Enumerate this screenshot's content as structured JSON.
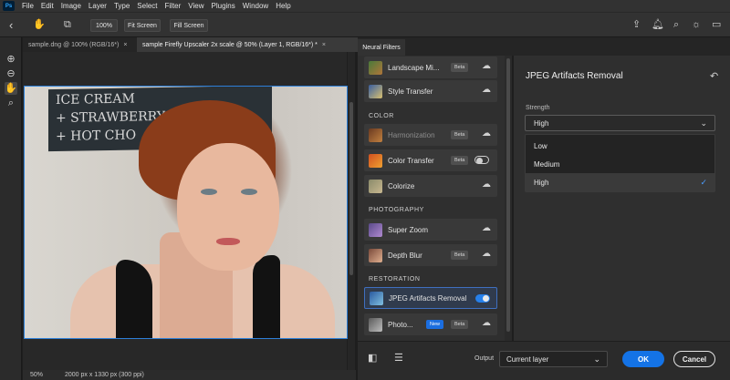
{
  "app": {
    "logo_text": "Ps"
  },
  "menu": [
    "File",
    "Edit",
    "Image",
    "Layer",
    "Type",
    "Select",
    "Filter",
    "View",
    "Plugins",
    "Window",
    "Help"
  ],
  "options_bar": {
    "zoom_value": "100%",
    "fit_screen": "Fit Screen",
    "fill_screen": "Fill Screen",
    "icons": [
      "back-arrow-icon",
      "hand-icon",
      "scroll-all-windows-icon",
      "share-icon",
      "cloud-docs-icon",
      "notifications-icon",
      "search-icon",
      "tips-icon",
      "workspace-icon"
    ]
  },
  "tools": [
    "zoom-in-icon",
    "zoom-out-icon",
    "hand-icon",
    "search-icon"
  ],
  "document_tabs": [
    {
      "label": "sample.dng @ 100% (RGB/16*)",
      "active": false
    },
    {
      "label": "sample Firefly Upscaler 2x scale @ 50% (Layer 1, RGB/16*) *",
      "active": true
    }
  ],
  "canvas": {
    "board_text": [
      "ICE CREAM",
      "+ STRAWBERRY",
      "+ HOT CHO"
    ]
  },
  "status": {
    "zoom": "50%",
    "dimensions": "2000 px x 1330 px (300 ppi)"
  },
  "neural_filters": {
    "panel_tab": "Neural Filters",
    "colors": {
      "accent": "#1473e6",
      "selected_border": "#3f6fbf",
      "toggle_on": "#2680eb",
      "new_badge": "#1b6ee0"
    },
    "sections": {
      "color": "COLOR",
      "photography": "PHOTOGRAPHY",
      "restoration": "RESTORATION"
    },
    "badges": {
      "beta": "Beta",
      "new": "New"
    },
    "filters": [
      {
        "label": "Landscape Mi...",
        "badge": "Beta",
        "action": "cloud-download-icon"
      },
      {
        "label": "Style Transfer",
        "action": "cloud-download-icon"
      },
      {
        "label": "Harmonization",
        "badge": "Beta",
        "action": "cloud-download-icon",
        "disabled": true
      },
      {
        "label": "Color Transfer",
        "badge": "Beta",
        "toggle": "off"
      },
      {
        "label": "Colorize",
        "action": "cloud-download-icon"
      },
      {
        "label": "Super Zoom",
        "action": "cloud-download-icon"
      },
      {
        "label": "Depth Blur",
        "badge": "Beta",
        "action": "cloud-download-icon"
      },
      {
        "label": "JPEG Artifacts Removal",
        "toggle": "on",
        "selected": true
      },
      {
        "label": "Photo...",
        "badge": "Beta",
        "new": "New",
        "action": "cloud-download-icon"
      }
    ],
    "settings": {
      "title": "JPEG Artifacts Removal",
      "strength_label": "Strength",
      "strength_value": "High",
      "options": [
        "Low",
        "Medium",
        "High"
      ],
      "selected_option": "High"
    },
    "output_label": "Output",
    "output_value": "Current layer",
    "ok": "OK",
    "cancel": "Cancel"
  }
}
